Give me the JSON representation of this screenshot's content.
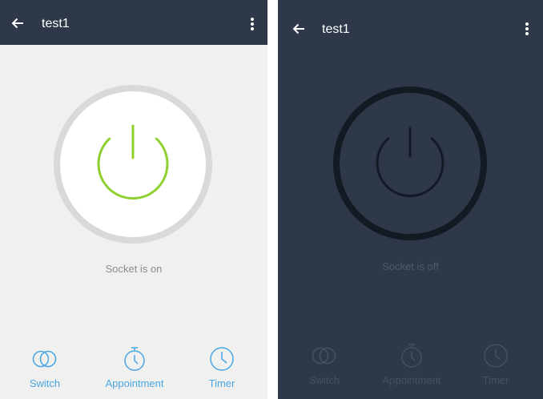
{
  "colors": {
    "appbar": "#2e3848",
    "on_background": "#f0f0ee",
    "off_background": "#2e3848",
    "power_on": "#8ed12f",
    "nav_active": "#48a6e5",
    "nav_dimmed": "#46505e"
  },
  "screens": [
    {
      "state": "on",
      "header": {
        "back_icon": "arrow-left-icon",
        "title": "test1",
        "menu_icon": "more-vertical-icon"
      },
      "power_icon": "power-icon",
      "status": "Socket is on",
      "nav": [
        {
          "label": "Switch",
          "icon": "toggle-circles-icon"
        },
        {
          "label": "Appointment",
          "icon": "stopwatch-icon"
        },
        {
          "label": "Timer",
          "icon": "clock-icon"
        }
      ]
    },
    {
      "state": "off",
      "header": {
        "back_icon": "arrow-left-icon",
        "title": "test1",
        "menu_icon": "more-vertical-icon"
      },
      "power_icon": "power-icon",
      "status": "Socket is off",
      "nav": [
        {
          "label": "Switch",
          "icon": "toggle-circles-icon"
        },
        {
          "label": "Appointment",
          "icon": "stopwatch-icon"
        },
        {
          "label": "Timer",
          "icon": "clock-icon"
        }
      ]
    }
  ]
}
